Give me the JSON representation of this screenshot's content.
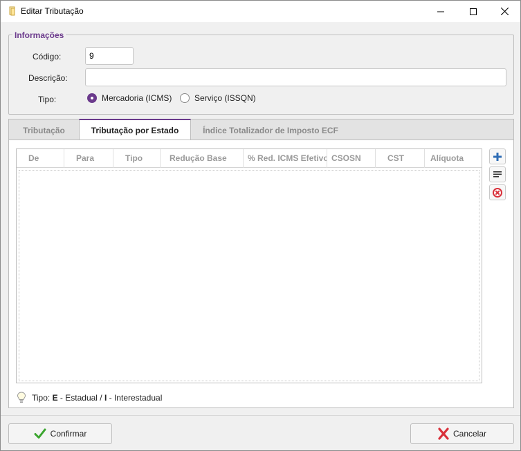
{
  "window": {
    "title": "Editar Tributação"
  },
  "informacoes": {
    "group_title": "Informações",
    "codigo_label": "Código:",
    "codigo_value": "9",
    "descricao_label": "Descrição:",
    "descricao_value": "",
    "tipo_label": "Tipo:",
    "tipo_options": [
      {
        "label": "Mercadoria (ICMS)",
        "checked": true
      },
      {
        "label": "Serviço (ISSQN)",
        "checked": false
      }
    ]
  },
  "tabs": [
    {
      "label": "Tributação",
      "active": false
    },
    {
      "label": "Tributação por Estado",
      "active": true
    },
    {
      "label": "Índice Totalizador de Imposto ECF",
      "active": false
    }
  ],
  "table": {
    "columns": [
      "De",
      "Para",
      "Tipo",
      "Redução Base",
      "% Red. ICMS Efetivo",
      "CSOSN",
      "CST",
      "Alíquota"
    ],
    "rows": []
  },
  "hint": {
    "prefix": "Tipo: ",
    "e_letter": "E",
    "e_text": " - Estadual / ",
    "i_letter": "I",
    "i_text": " - Interestadual"
  },
  "buttons": {
    "confirmar": "Confirmar",
    "cancelar": "Cancelar"
  },
  "colors": {
    "accent": "#6b3a8c",
    "add_icon": "#2f6db5",
    "delete_icon": "#d9303a",
    "confirm_icon": "#3aa52e"
  }
}
